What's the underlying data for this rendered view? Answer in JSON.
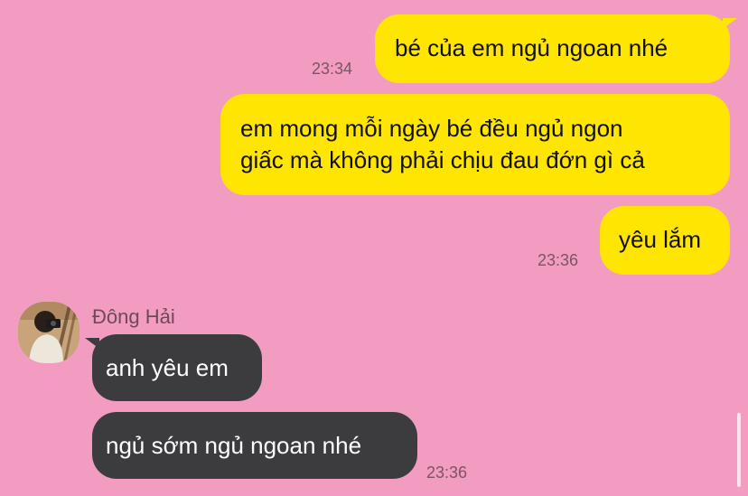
{
  "chat": {
    "messages": [
      {
        "direction": "out",
        "text": "bé của em ngủ ngoan nhé",
        "time": "23:34"
      },
      {
        "direction": "out",
        "line1": "em mong mỗi ngày bé đều ngủ ngon",
        "line2": "giấc mà không phải chịu đau đớn gì cả"
      },
      {
        "direction": "out",
        "text": "yêu lắm",
        "time": "23:36"
      },
      {
        "direction": "in",
        "sender": "Đông Hải",
        "text": "anh yêu em"
      },
      {
        "direction": "in",
        "text": "ngủ sớm ngủ ngoan nhé",
        "time": "23:36"
      }
    ]
  },
  "colors": {
    "background": "#f29cc2",
    "outgoing_bubble": "#ffe502",
    "incoming_bubble": "#3c3c3f",
    "timestamp": "#7a5563"
  }
}
